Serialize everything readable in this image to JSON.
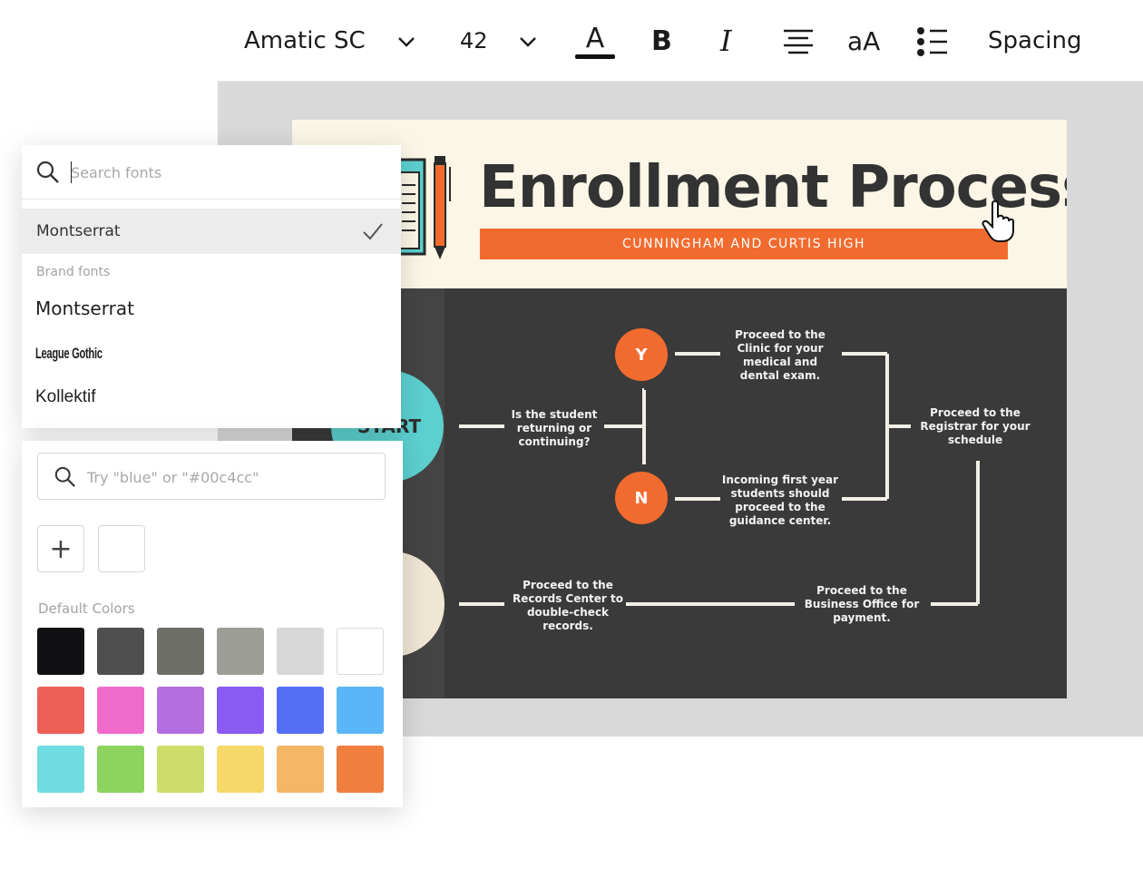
{
  "toolbar": {
    "font_name": "Amatic SC",
    "font_size": "42",
    "text_color_icon": "text-color-icon",
    "bold_label": "B",
    "italic_label": "I",
    "case_label": "aA",
    "spacing_label": "Spacing"
  },
  "design": {
    "title": "Enrollment Process",
    "subtitle": "CUNNINGHAM AND CURTIS HIGH",
    "start_label": "START",
    "yes_label": "Y",
    "no_label": "N",
    "step_question": "Is the student returning or continuing?",
    "step_clinic": "Proceed to the Clinic for your medical and dental exam.",
    "step_first_year": "Incoming first year students should proceed to the guidance center.",
    "step_registrar": "Proceed to the Registrar for your schedule",
    "step_records": "Proceed to the Records Center to double-check records.",
    "step_business": "Proceed to the Business Office for payment.",
    "colors": {
      "orange": "#f26b2e",
      "teal": "#5ccfcf",
      "dark": "#3a3a3a",
      "cream": "#fbf6e6"
    }
  },
  "font_panel": {
    "search_placeholder": "Search fonts",
    "selected_font": "Montserrat",
    "brand_heading": "Brand fonts",
    "fonts": [
      "Montserrat",
      "League Gothic",
      "Kollektif"
    ]
  },
  "color_panel": {
    "search_placeholder": "Try \"blue\" or \"#00c4cc\"",
    "add_label": "+",
    "default_heading": "Default Colors",
    "swatches": [
      "#111114",
      "#4f4f4f",
      "#6e6e69",
      "#9d9d98",
      "#d7d7d7",
      "#ffffff",
      "#ec5f55",
      "#ee6bcb",
      "#b46ee0",
      "#8a5bf2",
      "#546ef5",
      "#5ab6f7",
      "#6fdcdf",
      "#8dd35f",
      "#cddd6a",
      "#f6d86a",
      "#f3b766",
      "#f07f3f"
    ]
  }
}
